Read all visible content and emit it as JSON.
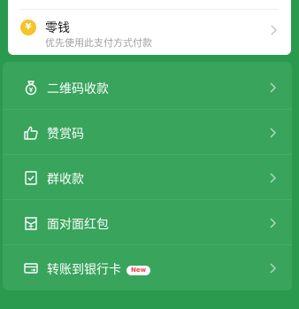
{
  "wallet_card": {
    "icon": "yuan-coin-icon",
    "symbol": "¥",
    "title": "零钱",
    "subtitle": "优先使用此支付方式付款"
  },
  "menu": [
    {
      "label": "二维码收款",
      "icon": "qr-money-bag-icon"
    },
    {
      "label": "赞赏码",
      "icon": "thumbs-up-icon"
    },
    {
      "label": "群收款",
      "icon": "group-receipt-icon"
    },
    {
      "label": "面对面红包",
      "icon": "red-packet-icon"
    },
    {
      "label": "转账到银行卡",
      "icon": "bank-card-transfer-icon",
      "badge": "New"
    }
  ],
  "colors": {
    "background": "#2a9a4e",
    "panel": "#38a45c",
    "coin": "#f5c42a",
    "badge_text": "#e84545"
  }
}
